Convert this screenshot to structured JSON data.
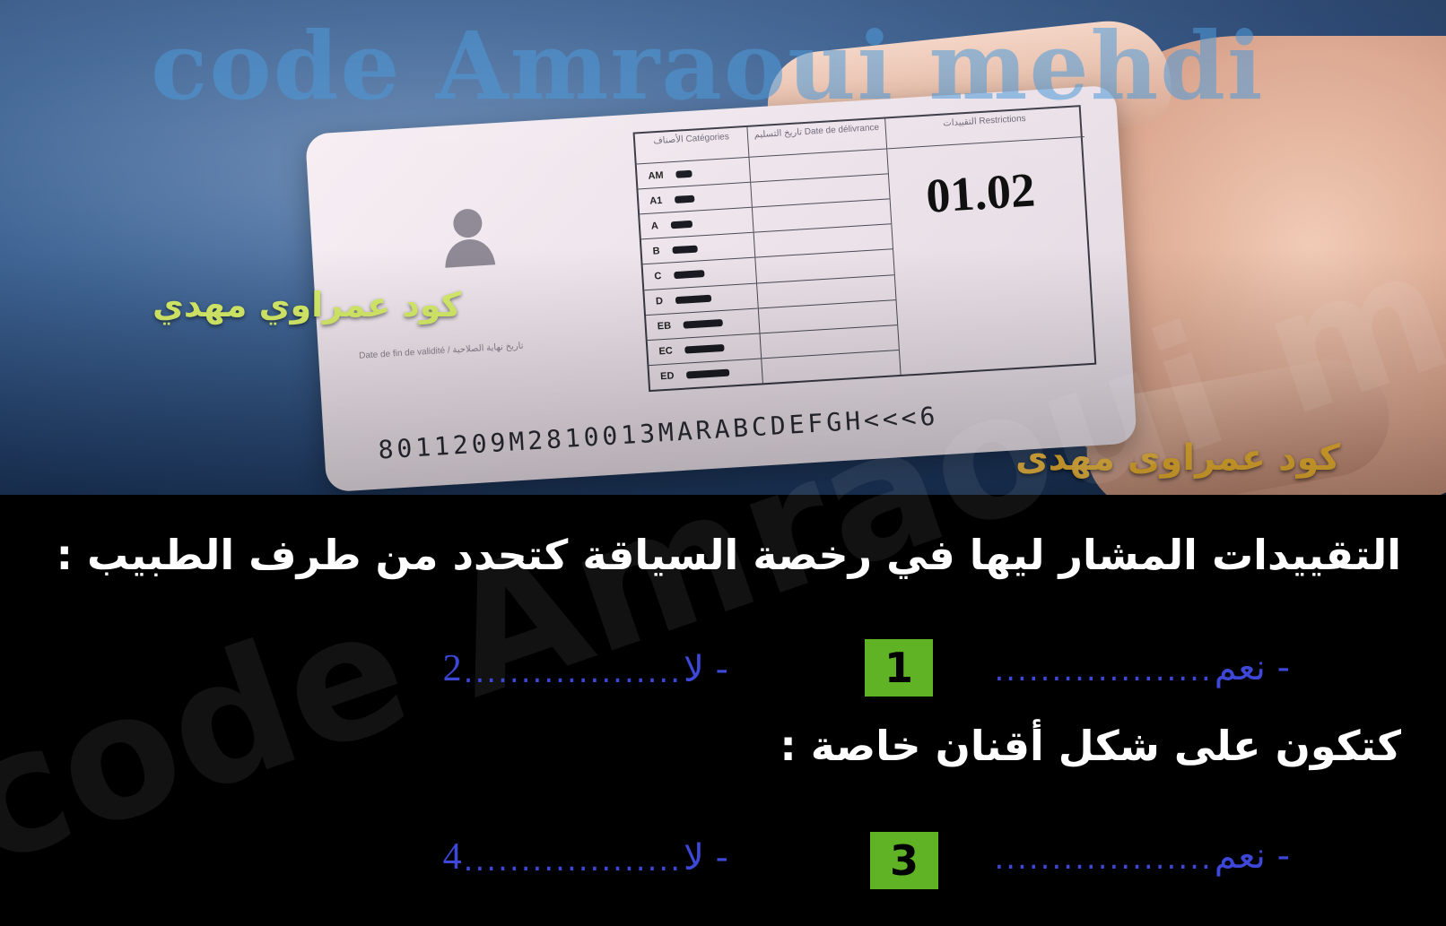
{
  "watermark_top": "code Amraoui mehdi",
  "watermark_diagonal": "code Amraoui mehdi",
  "overlay_label_yellow": "كود عمراوي مهدي",
  "overlay_label_gold": "كود عمراوى مهدى",
  "license_card": {
    "restriction_value": "01.02",
    "mrz_line": "8011209M2810013MARABCDEFGH<<<6",
    "column_headers": {
      "categories": "الأصناف Catégories",
      "delivery_date": "تاريخ التسليم Date de délivrance",
      "restrictions": "التقييدات Restrictions"
    },
    "categories": [
      "AM",
      "A1",
      "A",
      "B",
      "C",
      "D",
      "EB",
      "EC",
      "ED"
    ],
    "validity_text": "Date de fin de validité / تاريخ نهاية الصلاحية"
  },
  "question1": {
    "text": "التقييدات المشار ليها في رخصة السياقة كتحدد من طرف الطبيب :",
    "option_yes": "- نعم",
    "dots": "...................",
    "option_no": "- لا",
    "answer_yes_number": "1",
    "answer_no_number": "2"
  },
  "question2": {
    "text": "كتكون على شكل أقنان خاصة :",
    "option_yes": "- نعم",
    "dots": "...................",
    "option_no": "- لا",
    "answer_yes_number": "3",
    "answer_no_number": "4"
  },
  "colors": {
    "answer_box": "#5fb324",
    "option_text": "#3d47d8",
    "label_yellow": "#d9f06a",
    "label_gold": "#f0b632"
  }
}
